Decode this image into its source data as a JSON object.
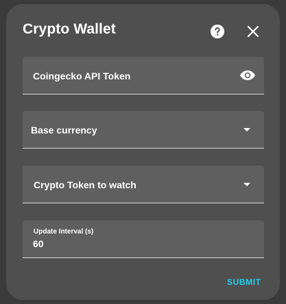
{
  "dialog": {
    "title": "Crypto Wallet",
    "help_icon": "help-circle-icon",
    "close_icon": "close-icon"
  },
  "fields": {
    "api_token": {
      "label": "Coingecko API Token",
      "value": "",
      "icon": "eye-icon"
    },
    "base_currency": {
      "label": "Base currency",
      "selected": "",
      "icon": "chevron-down-icon"
    },
    "crypto_token": {
      "label": "Crypto Token to watch",
      "selected": "",
      "icon": "chevron-down-icon"
    },
    "update_interval": {
      "label": "Update Interval (s)",
      "value": "60"
    }
  },
  "actions": {
    "submit_label": "SUBMIT"
  },
  "colors": {
    "dialog_bg": "#4f4f4f",
    "field_bg": "#5f5f5f",
    "accent": "#21d0f0",
    "text": "#ffffff"
  }
}
